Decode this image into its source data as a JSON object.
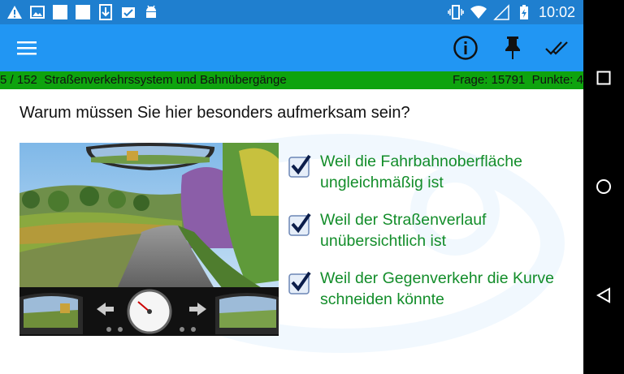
{
  "status_bar": {
    "time": "10:02",
    "left_icons": [
      "warning-icon",
      "image-icon",
      "blank-square-icon",
      "blank-square-icon",
      "download-icon",
      "photo-check-icon",
      "android-icon"
    ],
    "right_icons": [
      "vibrate-icon",
      "wifi-icon",
      "signal-icon",
      "battery-charging-icon"
    ]
  },
  "toolbar": {
    "menu_icon": "hamburger-menu-icon",
    "info_icon": "info-icon",
    "pin_icon": "pin-icon",
    "check_icon": "double-check-icon"
  },
  "infobar": {
    "left": "5 / 152  Straßenverkehrssystem und Bahnübergänge",
    "right": "Frage: 15791  Punkte: 4"
  },
  "question": "Warum müssen Sie hier besonders aufmerksam sein?",
  "answers": [
    {
      "text": "Weil die Fahrbahnoberfläche ungleichmäßig ist",
      "checked": true
    },
    {
      "text": "Weil der Straßenverlauf unübersichtlich ist",
      "checked": true
    },
    {
      "text": "Weil der Gegenverkehr die Kurve schneiden könnte",
      "checked": true
    }
  ],
  "colors": {
    "status_bar": "#1f7fcf",
    "toolbar": "#2196f3",
    "info_bar": "#0ea30e",
    "answer_text": "#138d2a",
    "nav_bar": "#000000"
  },
  "nav_bar": [
    "back-icon",
    "home-icon",
    "recents-icon"
  ]
}
